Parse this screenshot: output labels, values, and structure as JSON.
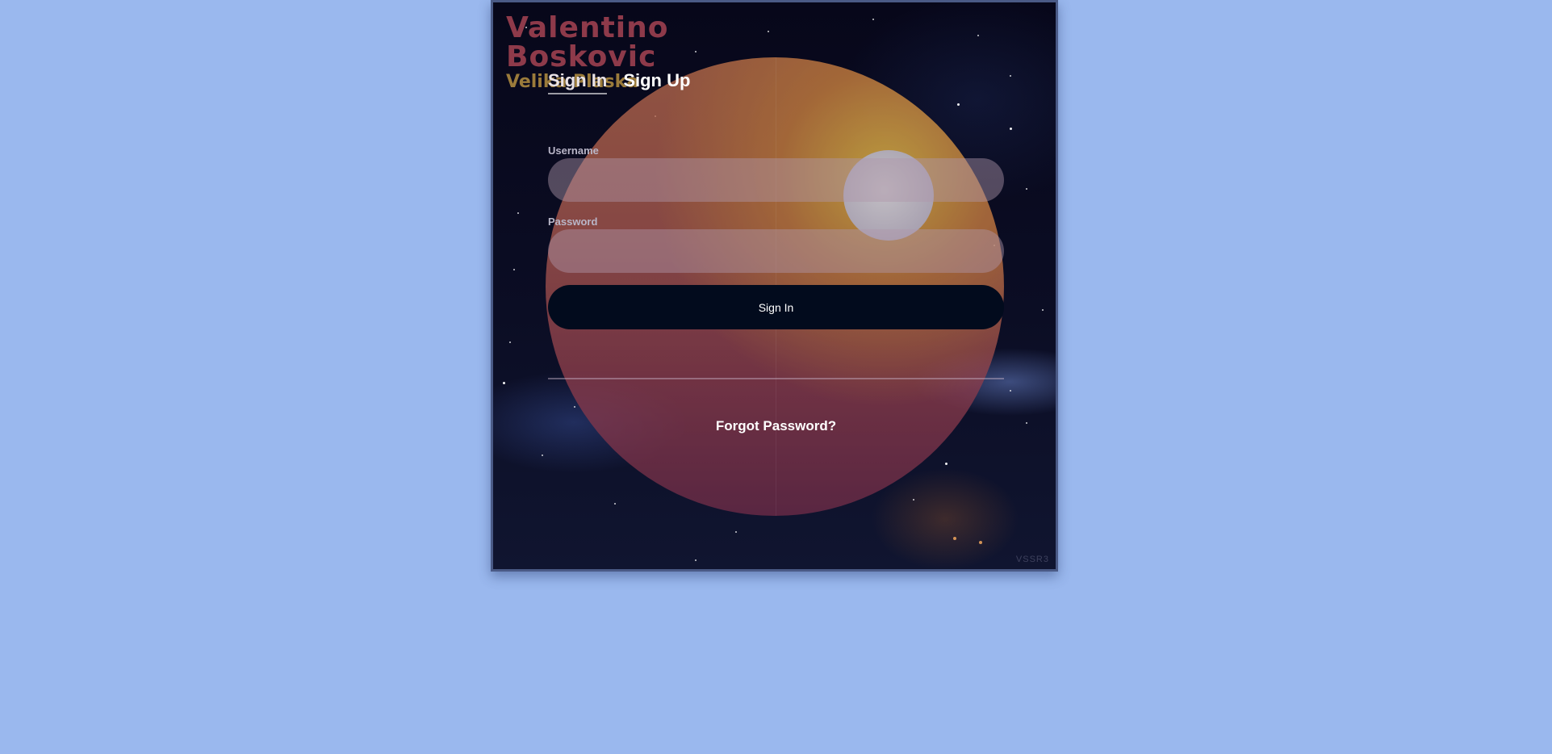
{
  "brand": {
    "line1": "Valentino",
    "line2": "Boskovic",
    "line3": "Velika Plaska"
  },
  "tabs": [
    {
      "label": "Sign In",
      "active": true
    },
    {
      "label": "Sign Up",
      "active": false
    }
  ],
  "form": {
    "username_label": "Username",
    "username_value": "",
    "password_label": "Password",
    "password_value": "",
    "submit_label": "Sign In",
    "forgot_label": "Forgot Password?"
  },
  "watermark": "VSSR3",
  "colors": {
    "page_background": "#9ab8ee",
    "button": "#020b1d",
    "brand_name": "#8e3a4a",
    "brand_place": "#9b7b3b"
  }
}
